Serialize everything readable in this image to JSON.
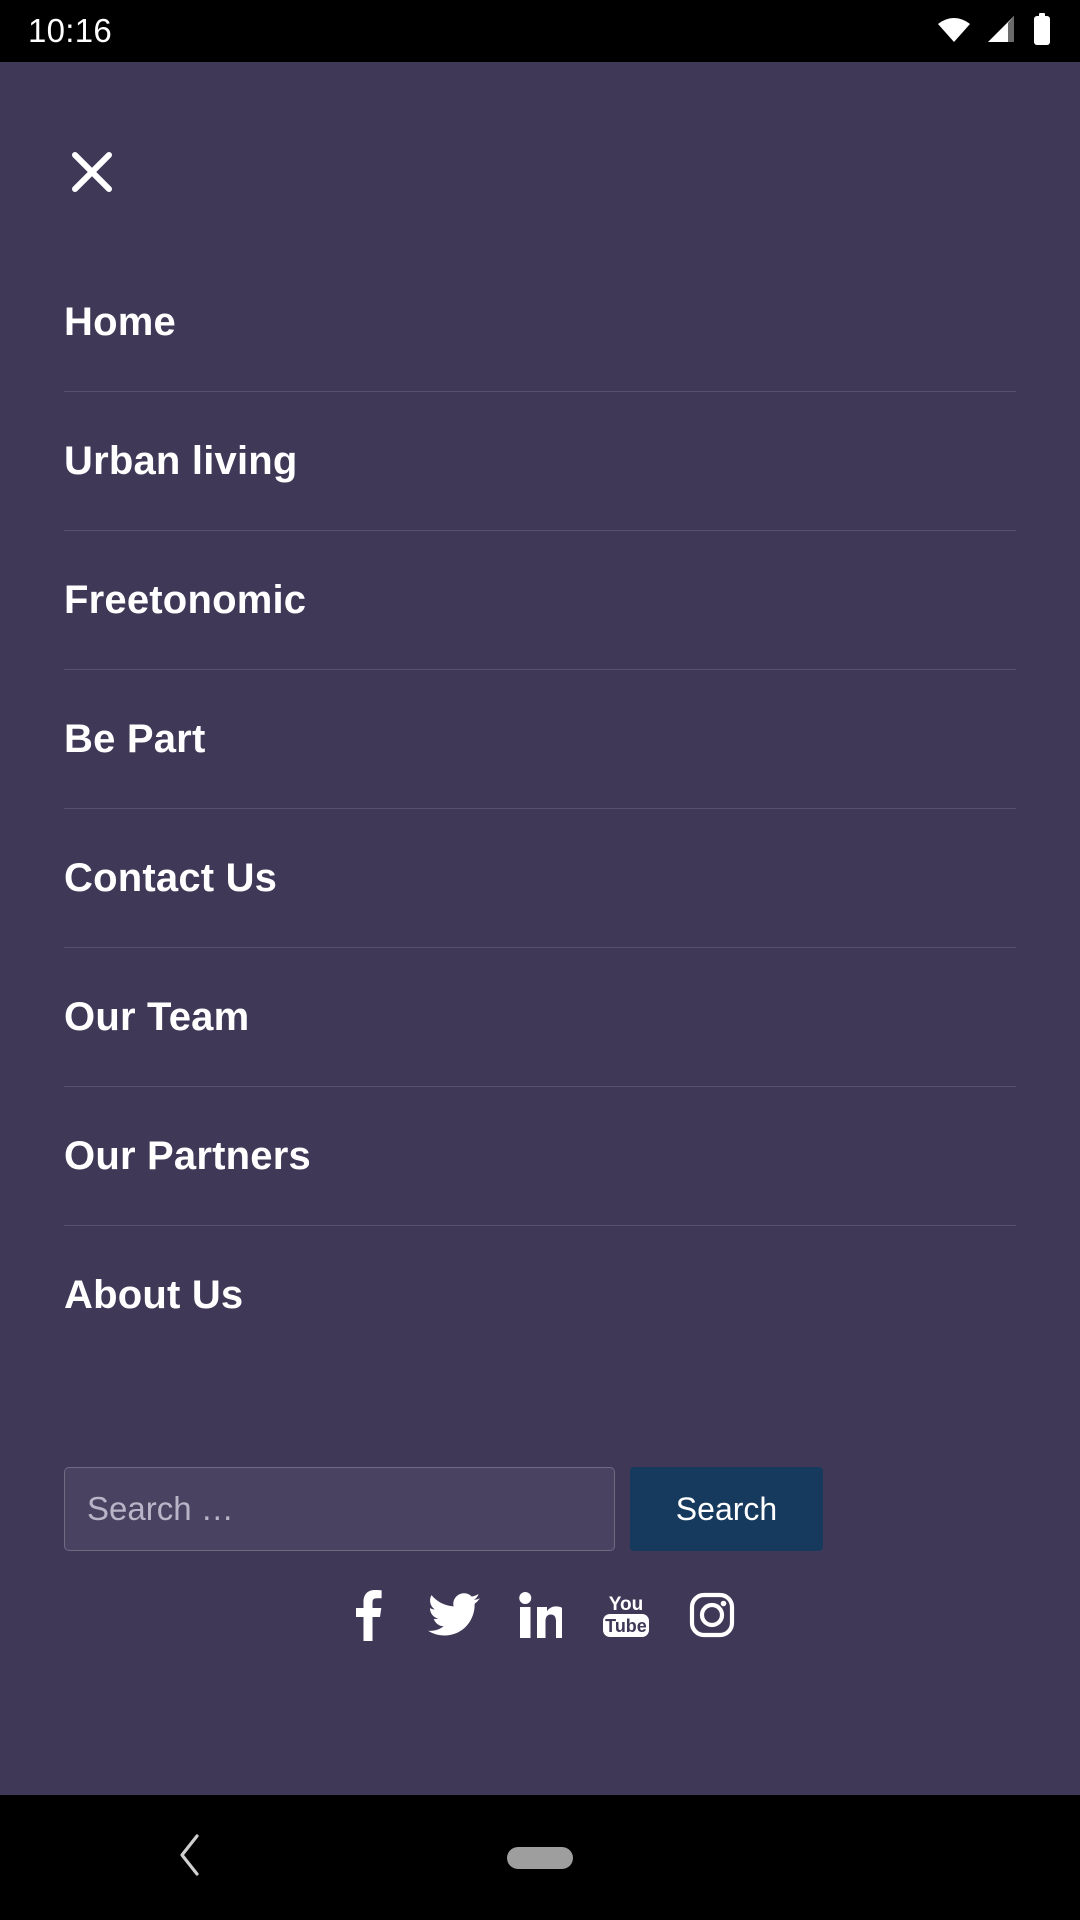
{
  "status_bar": {
    "time": "10:16",
    "icons": [
      "wifi-icon",
      "cellular-signal-icon",
      "battery-icon"
    ]
  },
  "drawer": {
    "background_color": "#3f3857",
    "close_icon": "close-icon",
    "nav_items": [
      {
        "label": "Home"
      },
      {
        "label": "Urban living"
      },
      {
        "label": "Freetonomic"
      },
      {
        "label": "Be Part"
      },
      {
        "label": "Contact Us"
      },
      {
        "label": "Our Team"
      },
      {
        "label": "Our Partners"
      },
      {
        "label": "About Us"
      }
    ],
    "social_links": [
      {
        "name": "facebook-icon"
      },
      {
        "name": "twitter-icon"
      },
      {
        "name": "linkedin-icon"
      },
      {
        "name": "youtube-icon"
      },
      {
        "name": "instagram-icon"
      }
    ],
    "search": {
      "placeholder": "Search …",
      "value": "",
      "button_label": "Search",
      "button_color": "#163a5e"
    }
  },
  "system_nav": {
    "back_icon": "back-chevron-icon",
    "home_indicator": "home-pill-indicator"
  }
}
